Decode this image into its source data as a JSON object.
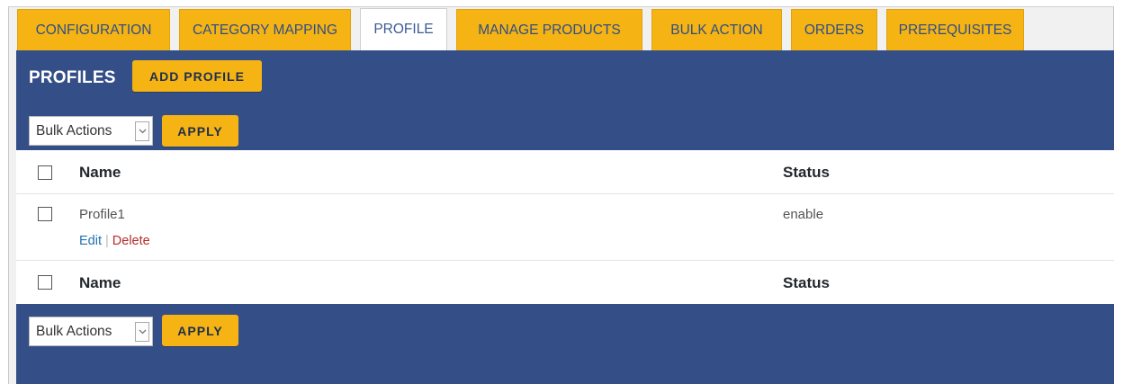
{
  "tabs": [
    {
      "label": "CONFIGURATION",
      "active": false
    },
    {
      "label": "CATEGORY MAPPING",
      "active": false
    },
    {
      "label": "PROFILE",
      "active": true
    },
    {
      "label": "MANAGE PRODUCTS",
      "active": false
    },
    {
      "label": "BULK ACTION",
      "active": false
    },
    {
      "label": "ORDERS",
      "active": false
    },
    {
      "label": "PREREQUISITES",
      "active": false
    }
  ],
  "header": {
    "title": "PROFILES",
    "add_button": "ADD PROFILE"
  },
  "bulk_top": {
    "select_value": "Bulk Actions",
    "apply_label": "APPLY"
  },
  "bulk_bottom": {
    "select_value": "Bulk Actions",
    "apply_label": "APPLY"
  },
  "table": {
    "columns": [
      "Name",
      "Status"
    ],
    "rows": [
      {
        "name": "Profile1",
        "status": "enable",
        "actions": {
          "edit": "Edit",
          "separator": "|",
          "delete": "Delete"
        }
      }
    ]
  },
  "colors": {
    "accent": "#f5b314",
    "panel": "#344f87",
    "edit_link": "#2271b1",
    "delete_link": "#b32d2e"
  }
}
